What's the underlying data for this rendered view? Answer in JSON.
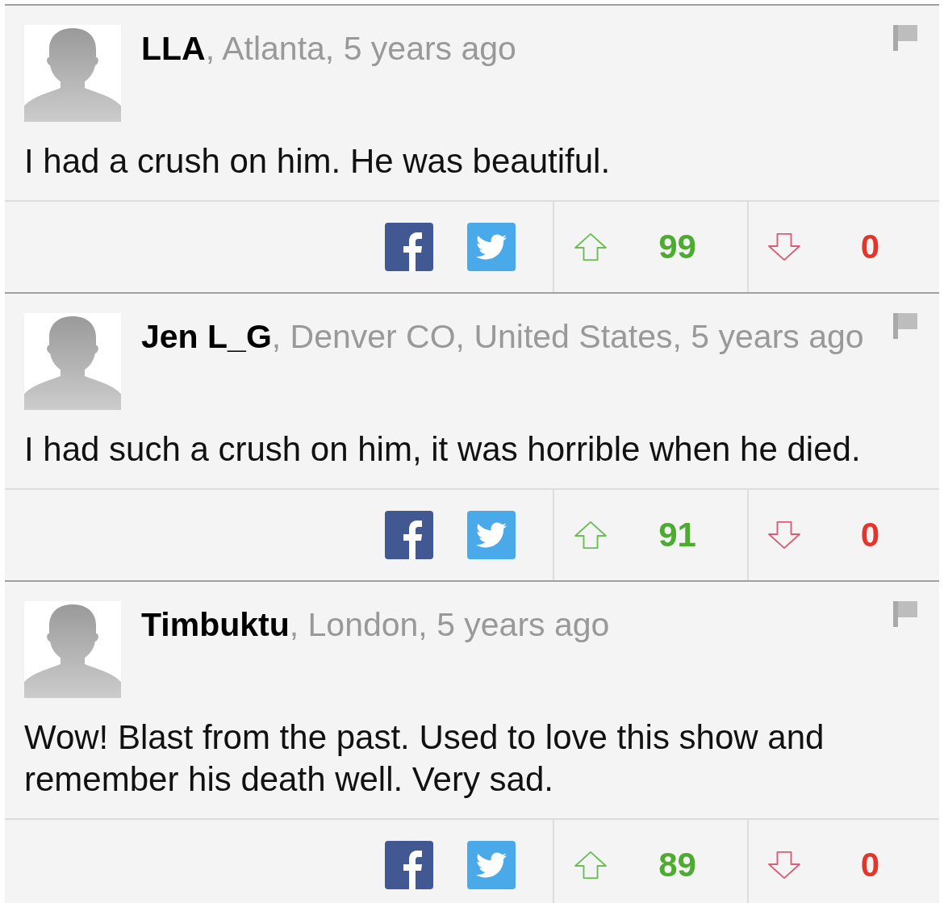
{
  "comments": [
    {
      "author": "LLA",
      "meta": ", Atlanta, 5 years ago",
      "text": "I had a crush on him. He was beautiful.",
      "upvotes": "99",
      "downvotes": "0"
    },
    {
      "author": "Jen L_G",
      "meta": ", Denver CO, United States, 5 years ago",
      "text": "I had such a crush on him, it was horrible when he died.",
      "upvotes": "91",
      "downvotes": "0"
    },
    {
      "author": "Timbuktu",
      "meta": ", London, 5 years ago",
      "text": "Wow! Blast from the past. Used to love this show and remember his death well. Very sad.",
      "upvotes": "89",
      "downvotes": "0"
    }
  ]
}
